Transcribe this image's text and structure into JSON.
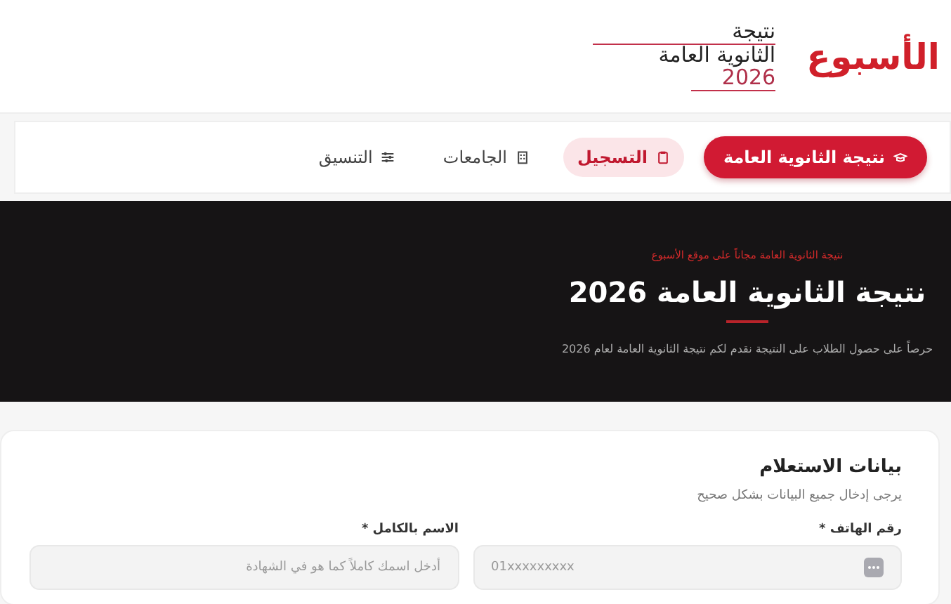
{
  "header": {
    "logo": "الأسبوع",
    "title_lines": [
      "نتيجة",
      "الثانوية العامة",
      "2026"
    ]
  },
  "nav": [
    {
      "label": "نتيجة الثانوية العامة",
      "kind": "primary",
      "selected": false
    },
    {
      "label": "التسجيل",
      "kind": "link",
      "selected": true
    },
    {
      "label": "الجامعات",
      "kind": "link",
      "selected": false
    },
    {
      "label": "التنسيق",
      "kind": "link",
      "selected": false
    }
  ],
  "hero": {
    "eyebrow": "نتيجة الثانوية العامة مجاناً على موقع الأسبوع",
    "title": "نتيجة الثانوية العامة 2026",
    "subtitle": "حرصاً على حصول الطلاب على النتيجة نقدم لكم نتيجة الثانوية العامة لعام 2026"
  },
  "form": {
    "title": "بيانات الاستعلام",
    "hint": "يرجى إدخال جميع البيانات بشكل صحيح",
    "fields": [
      {
        "label": "رقم الهاتف *",
        "placeholder": "01xxxxxxxxx",
        "kind": "phone"
      },
      {
        "label": "الاسم بالكامل *",
        "placeholder": "أدخل اسمك كاملاً كما هو في الشهادة",
        "kind": "text"
      }
    ]
  }
}
